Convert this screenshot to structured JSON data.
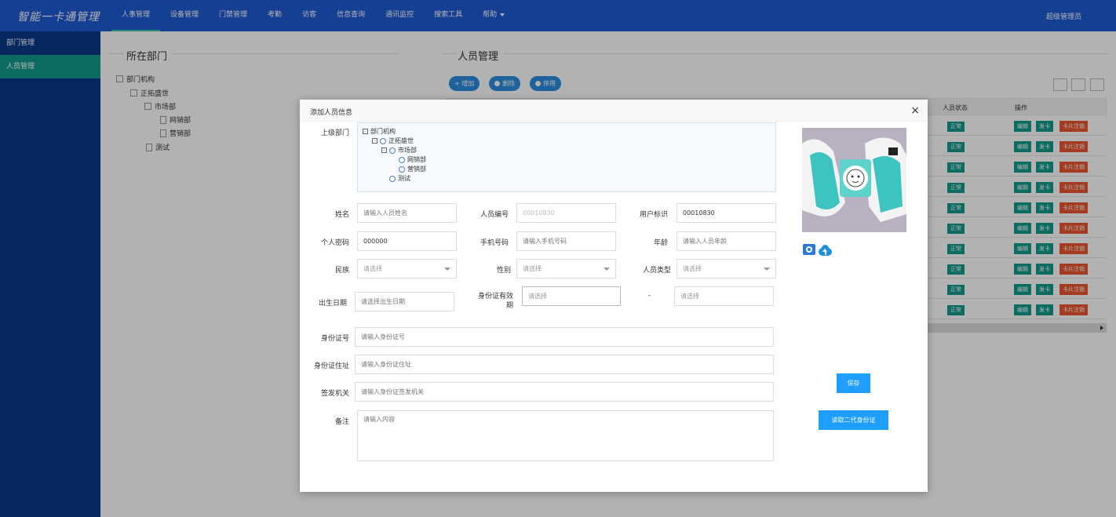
{
  "app": {
    "logo_text": "智能一卡通管理",
    "user": "超级管理员"
  },
  "nav": [
    {
      "label": "人事管理",
      "active": true
    },
    {
      "label": "设备管理"
    },
    {
      "label": "门禁管理"
    },
    {
      "label": "考勤"
    },
    {
      "label": "访客"
    },
    {
      "label": "信息查询"
    },
    {
      "label": "通讯监控"
    },
    {
      "label": "搜索工具"
    },
    {
      "label": "帮助"
    }
  ],
  "sidebar": {
    "items": [
      {
        "label": "部门管理"
      },
      {
        "label": "人员管理",
        "active": true
      }
    ]
  },
  "dept_panel": {
    "title": "所在部门",
    "tree": [
      {
        "label": "部门机构"
      },
      {
        "label": "正拓盛世"
      },
      {
        "label": "市场部"
      },
      {
        "label": "网销部"
      },
      {
        "label": "营销部"
      },
      {
        "label": "测试"
      }
    ]
  },
  "people_panel": {
    "title": "人员管理",
    "toolbar": {
      "add": "增加",
      "delete": "删除",
      "disable": "停用"
    },
    "columns": {
      "status": "人员状态",
      "ops": "操作"
    },
    "rows": [
      {
        "status": "正常"
      },
      {
        "status": "正常"
      },
      {
        "status": "正常"
      },
      {
        "status": "正常"
      },
      {
        "status": "正常"
      },
      {
        "status": "正常"
      },
      {
        "status": "正常"
      },
      {
        "status": "正常"
      },
      {
        "status": "正常"
      },
      {
        "status": "正常"
      }
    ],
    "ops": {
      "edit": "编辑",
      "issue": "发卡",
      "cancel": "卡片注销"
    }
  },
  "modal": {
    "title": "添加人员信息",
    "close": "×",
    "parent_dept_label": "上级部门",
    "dept_tree": [
      {
        "label": "部门机构"
      },
      {
        "label": "正拓盛世"
      },
      {
        "label": "市场部"
      },
      {
        "label": "网销部"
      },
      {
        "label": "营销部"
      },
      {
        "label": "测试"
      }
    ],
    "fields": {
      "name": {
        "label": "姓名",
        "placeholder": "请输入人员姓名"
      },
      "emp_no": {
        "label": "人员编号",
        "value": "00010830"
      },
      "user_id": {
        "label": "用户标识",
        "value": "00010830"
      },
      "password": {
        "label": "个人密码",
        "value": "000000"
      },
      "phone": {
        "label": "手机号码",
        "placeholder": "请输入手机号码"
      },
      "age": {
        "label": "年龄",
        "placeholder": "请输入人员年龄"
      },
      "ethnicity": {
        "label": "民族",
        "value": "请选择"
      },
      "gender": {
        "label": "性别",
        "value": "请选择"
      },
      "person_type": {
        "label": "人员类型",
        "value": "请选择"
      },
      "birthday": {
        "label": "出生日期",
        "placeholder": "请选择出生日期"
      },
      "id_valid": {
        "label": "身份证有效期",
        "from": "请选择",
        "sep": "-",
        "to": "请选择"
      },
      "id_no": {
        "label": "身份证号",
        "placeholder": "请输入身份证号"
      },
      "id_addr": {
        "label": "身份证住址",
        "placeholder": "请输入身份证住址"
      },
      "issuer": {
        "label": "签发机关",
        "placeholder": "请输入身份证签发机关"
      },
      "remark": {
        "label": "备注",
        "placeholder": "请输入内容"
      }
    },
    "buttons": {
      "save": "保存",
      "read_id": "读取二代身份证"
    },
    "photo_icons": [
      "camera-icon",
      "cloud-upload-icon"
    ]
  },
  "colors": {
    "topbar": "#1f5bd3",
    "sidebar": "#0a3a8c",
    "accent": "#139b8c",
    "danger": "#e8552f",
    "primary": "#1e9fff"
  }
}
